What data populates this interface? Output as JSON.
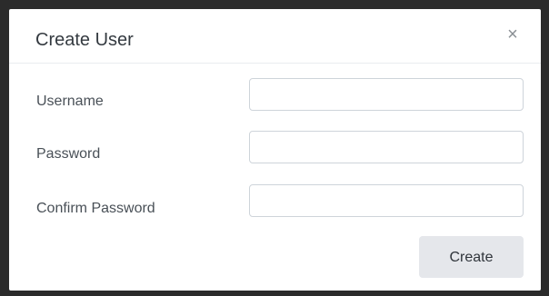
{
  "dialog": {
    "title": "Create User",
    "close_icon": "×"
  },
  "form": {
    "fields": [
      {
        "label": "Username",
        "value": "",
        "placeholder": ""
      },
      {
        "label": "Password",
        "value": "",
        "placeholder": ""
      },
      {
        "label": "Confirm Password",
        "value": "",
        "placeholder": ""
      }
    ],
    "submit_label": "Create"
  },
  "icons": {
    "close": "close-icon"
  }
}
